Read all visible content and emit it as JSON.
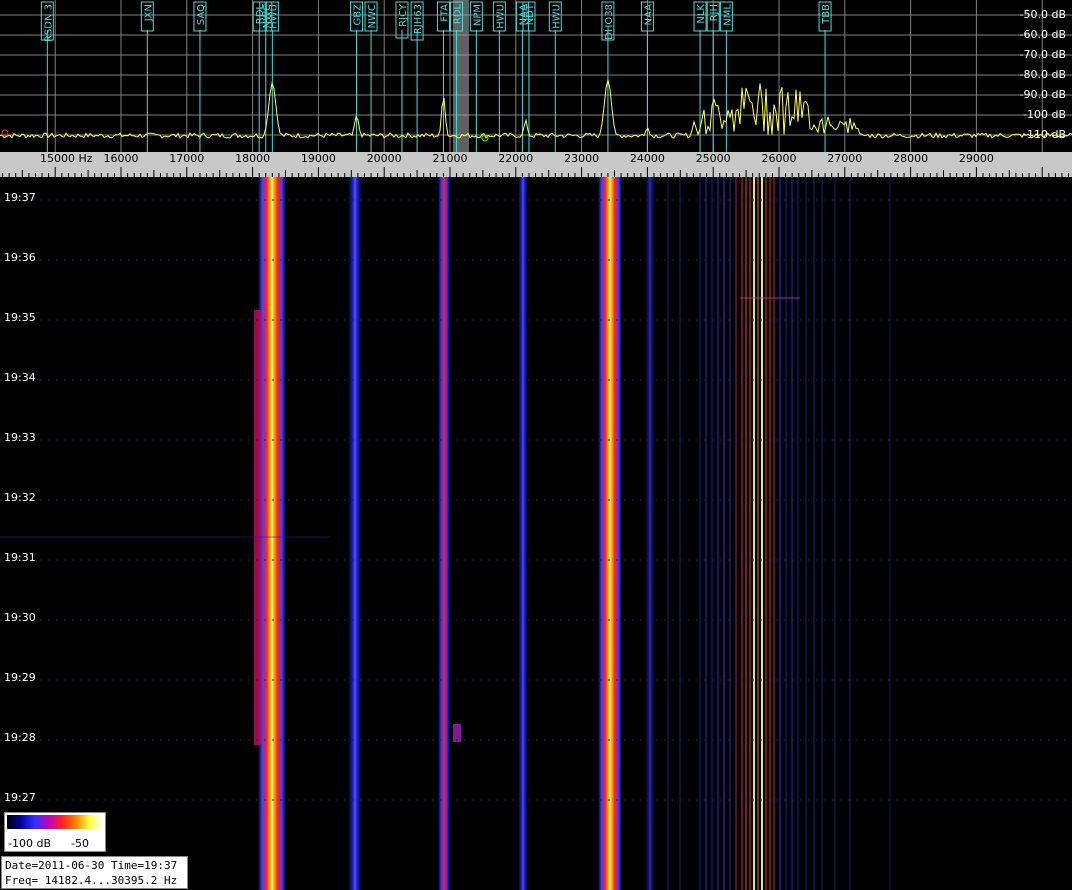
{
  "spectrum": {
    "db_labels": [
      "-50.0 dB",
      "-60.0 dB",
      "-70.0 dB",
      "-80.0 dB",
      "-90.0 dB",
      "-100 dB",
      "-110 dB"
    ],
    "stations": [
      {
        "label": "RSDN 3",
        "freq": 14880
      },
      {
        "label": "JXN",
        "freq": 16400
      },
      {
        "label": "SAQ",
        "freq": 17200
      },
      {
        "label": "RDL",
        "freq": 18100
      },
      {
        "label": "NWC",
        "freq": 18200
      },
      {
        "label": "HWU",
        "freq": 18300
      },
      {
        "label": "GBZ",
        "freq": 19580
      },
      {
        "label": "NWC",
        "freq": 19800
      },
      {
        "label": "RJCY",
        "freq": 20270
      },
      {
        "label": "RJH63",
        "freq": 20500
      },
      {
        "label": "FTA",
        "freq": 20900
      },
      {
        "label": "RDL",
        "freq": 21100
      },
      {
        "label": "NPM",
        "freq": 21400
      },
      {
        "label": "HWU",
        "freq": 21750
      },
      {
        "label": "NAA",
        "freq": 22100
      },
      {
        "label": "NDT",
        "freq": 22200
      },
      {
        "label": "HWU",
        "freq": 22600
      },
      {
        "label": "DHO38",
        "freq": 23400
      },
      {
        "label": "NAA",
        "freq": 24000
      },
      {
        "label": "NLK",
        "freq": 24800
      },
      {
        "label": "RJH",
        "freq": 25000
      },
      {
        "label": "NML",
        "freq": 25200
      },
      {
        "label": "TBB",
        "freq": 26700
      }
    ]
  },
  "scale": {
    "first_label": "15000 Hz",
    "labels": [
      "16000",
      "17000",
      "18000",
      "19000",
      "20000",
      "21000",
      "22000",
      "23000",
      "24000",
      "25000",
      "26000",
      "27000",
      "28000",
      "29000"
    ]
  },
  "waterfall": {
    "time_labels": [
      "19:37",
      "19:36",
      "19:35",
      "19:34",
      "19:33",
      "19:32",
      "19:31",
      "19:30",
      "19:29",
      "19:28",
      "19:27"
    ]
  },
  "legend": {
    "min_label": "-100 dB",
    "max_label": "-50",
    "colors": [
      "#000000",
      "#0000a0",
      "#3030ff",
      "#c000c0",
      "#ff2020",
      "#ff8000",
      "#ffff40",
      "#ffffff"
    ]
  },
  "info": {
    "date_line": "Date=2011-06-30 Time=19:37",
    "freq_line": "Freq= 14182.4...30395.2 Hz"
  },
  "colors": {
    "grid": "#808080",
    "trace": "#ffff50",
    "marker": "#40e0e0"
  }
}
